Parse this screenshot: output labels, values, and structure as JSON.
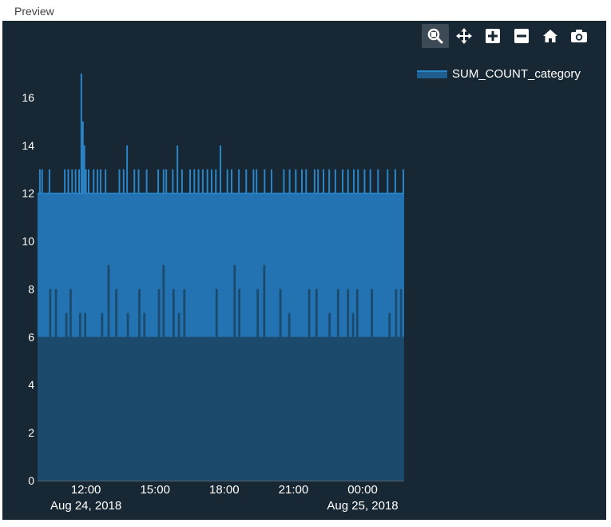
{
  "header": {
    "title": "Preview"
  },
  "toolbar": {
    "buttons": [
      {
        "icon": "zoom-icon",
        "active": true
      },
      {
        "icon": "pan-icon",
        "active": false
      },
      {
        "icon": "zoom-in-icon",
        "active": false
      },
      {
        "icon": "zoom-out-icon",
        "active": false
      },
      {
        "icon": "home-icon",
        "active": false
      },
      {
        "icon": "camera-icon",
        "active": false
      }
    ]
  },
  "colors": {
    "background": "#172733",
    "area_base": "#1b4a6d",
    "area_band": "#2373b3",
    "line": "#2b86c9",
    "tick_text": "#ffffff"
  },
  "chart_data": {
    "type": "area",
    "legend": {
      "position": "top-right",
      "entries": [
        "SUM_COUNT_category"
      ]
    },
    "xaxis": {
      "type": "date",
      "range": [
        "2018-08-24 09:54",
        "2018-08-25 01:48"
      ],
      "ticks": [
        {
          "value": "2018-08-24 12:00",
          "label": "12:00",
          "sublabel": "Aug 24, 2018"
        },
        {
          "value": "2018-08-24 15:00",
          "label": "15:00",
          "sublabel": ""
        },
        {
          "value": "2018-08-24 18:00",
          "label": "18:00",
          "sublabel": ""
        },
        {
          "value": "2018-08-24 21:00",
          "label": "21:00",
          "sublabel": ""
        },
        {
          "value": "2018-08-25 00:00",
          "label": "00:00",
          "sublabel": "Aug 25, 2018"
        }
      ]
    },
    "yaxis": {
      "range": [
        0,
        17.6
      ],
      "ticks": [
        0,
        2,
        4,
        6,
        8,
        10,
        12,
        14,
        16
      ]
    },
    "grid": false,
    "series": [
      {
        "name": "SUM_COUNT_category",
        "baseline": 12,
        "spikes": [
          [
            "2018-08-24 10:00",
            13
          ],
          [
            "2018-08-24 10:06",
            13
          ],
          [
            "2018-08-24 10:25",
            13
          ],
          [
            "2018-08-24 11:05",
            13
          ],
          [
            "2018-08-24 11:14",
            13
          ],
          [
            "2018-08-24 11:24",
            13
          ],
          [
            "2018-08-24 11:33",
            13
          ],
          [
            "2018-08-24 11:42",
            13
          ],
          [
            "2018-08-24 11:48",
            17
          ],
          [
            "2018-08-24 11:52",
            15
          ],
          [
            "2018-08-24 11:56",
            14
          ],
          [
            "2018-08-24 12:00",
            13
          ],
          [
            "2018-08-24 12:07",
            13
          ],
          [
            "2018-08-24 12:20",
            13
          ],
          [
            "2018-08-24 12:30",
            13
          ],
          [
            "2018-08-24 12:38",
            13
          ],
          [
            "2018-08-24 12:51",
            13
          ],
          [
            "2018-08-24 13:27",
            13
          ],
          [
            "2018-08-24 13:38",
            13
          ],
          [
            "2018-08-24 13:47",
            14
          ],
          [
            "2018-08-24 14:06",
            13
          ],
          [
            "2018-08-24 14:17",
            13
          ],
          [
            "2018-08-24 14:38",
            13
          ],
          [
            "2018-08-24 15:08",
            13
          ],
          [
            "2018-08-24 15:22",
            13
          ],
          [
            "2018-08-24 15:29",
            13
          ],
          [
            "2018-08-24 15:46",
            13
          ],
          [
            "2018-08-24 15:58",
            14
          ],
          [
            "2018-08-24 16:10",
            13
          ],
          [
            "2018-08-24 16:31",
            13
          ],
          [
            "2018-08-24 16:42",
            13
          ],
          [
            "2018-08-24 16:53",
            13
          ],
          [
            "2018-08-24 17:04",
            13
          ],
          [
            "2018-08-24 17:16",
            13
          ],
          [
            "2018-08-24 17:27",
            13
          ],
          [
            "2018-08-24 17:38",
            13
          ],
          [
            "2018-08-24 17:50",
            14
          ],
          [
            "2018-08-24 18:08",
            13
          ],
          [
            "2018-08-24 18:19",
            13
          ],
          [
            "2018-08-24 18:38",
            13
          ],
          [
            "2018-08-24 18:57",
            13
          ],
          [
            "2018-08-24 19:16",
            13
          ],
          [
            "2018-08-24 19:24",
            13
          ],
          [
            "2018-08-24 19:45",
            13
          ],
          [
            "2018-08-24 20:03",
            13
          ],
          [
            "2018-08-24 20:35",
            13
          ],
          [
            "2018-08-24 20:50",
            13
          ],
          [
            "2018-08-24 21:06",
            13
          ],
          [
            "2018-08-24 21:22",
            13
          ],
          [
            "2018-08-24 21:33",
            13
          ],
          [
            "2018-08-24 21:55",
            13
          ],
          [
            "2018-08-24 22:04",
            13
          ],
          [
            "2018-08-24 22:18",
            13
          ],
          [
            "2018-08-24 22:33",
            13
          ],
          [
            "2018-08-24 22:49",
            13
          ],
          [
            "2018-08-24 23:08",
            13
          ],
          [
            "2018-08-24 23:22",
            13
          ],
          [
            "2018-08-24 23:37",
            13
          ],
          [
            "2018-08-24 23:48",
            13
          ],
          [
            "2018-08-25 00:05",
            13
          ],
          [
            "2018-08-25 00:20",
            13
          ],
          [
            "2018-08-25 00:40",
            13
          ],
          [
            "2018-08-25 01:05",
            13
          ],
          [
            "2018-08-25 01:25",
            13
          ],
          [
            "2018-08-25 01:46",
            13
          ]
        ],
        "dips": [
          [
            "2018-08-24 09:57",
            6
          ],
          [
            "2018-08-24 10:27",
            8
          ],
          [
            "2018-08-24 10:42",
            8
          ],
          [
            "2018-08-24 10:56",
            6
          ],
          [
            "2018-08-24 11:09",
            7
          ],
          [
            "2018-08-24 11:20",
            8
          ],
          [
            "2018-08-24 11:36",
            6
          ],
          [
            "2018-08-24 11:45",
            7
          ],
          [
            "2018-08-24 11:58",
            7
          ],
          [
            "2018-08-24 12:22",
            6
          ],
          [
            "2018-08-24 12:42",
            7
          ],
          [
            "2018-08-24 12:59",
            9
          ],
          [
            "2018-08-24 13:19",
            8
          ],
          [
            "2018-08-24 13:49",
            7
          ],
          [
            "2018-08-24 14:19",
            8
          ],
          [
            "2018-08-24 14:32",
            7
          ],
          [
            "2018-08-24 15:10",
            8
          ],
          [
            "2018-08-24 15:22",
            9
          ],
          [
            "2018-08-24 15:31",
            6
          ],
          [
            "2018-08-24 15:48",
            8
          ],
          [
            "2018-08-24 16:02",
            7
          ],
          [
            "2018-08-24 16:16",
            8
          ],
          [
            "2018-08-24 16:32",
            6
          ],
          [
            "2018-08-24 16:52",
            6
          ],
          [
            "2018-08-24 17:10",
            6
          ],
          [
            "2018-08-24 17:40",
            8
          ],
          [
            "2018-08-24 18:14",
            6
          ],
          [
            "2018-08-24 18:27",
            9
          ],
          [
            "2018-08-24 18:39",
            8
          ],
          [
            "2018-08-24 19:05",
            6
          ],
          [
            "2018-08-24 19:27",
            8
          ],
          [
            "2018-08-24 19:44",
            9
          ],
          [
            "2018-08-24 20:06",
            6
          ],
          [
            "2018-08-24 20:26",
            8
          ],
          [
            "2018-08-24 20:49",
            7
          ],
          [
            "2018-08-24 21:26",
            6
          ],
          [
            "2018-08-24 21:41",
            8
          ],
          [
            "2018-08-24 22:00",
            8
          ],
          [
            "2018-08-24 22:16",
            6
          ],
          [
            "2018-08-24 22:34",
            7
          ],
          [
            "2018-08-24 22:56",
            8
          ],
          [
            "2018-08-24 23:22",
            8
          ],
          [
            "2018-08-24 23:35",
            7
          ],
          [
            "2018-08-24 23:46",
            8
          ],
          [
            "2018-08-25 00:07",
            6
          ],
          [
            "2018-08-25 00:24",
            8
          ],
          [
            "2018-08-25 00:46",
            6
          ],
          [
            "2018-08-25 01:10",
            7
          ],
          [
            "2018-08-25 01:27",
            8
          ],
          [
            "2018-08-25 01:40",
            8
          ]
        ]
      }
    ]
  }
}
